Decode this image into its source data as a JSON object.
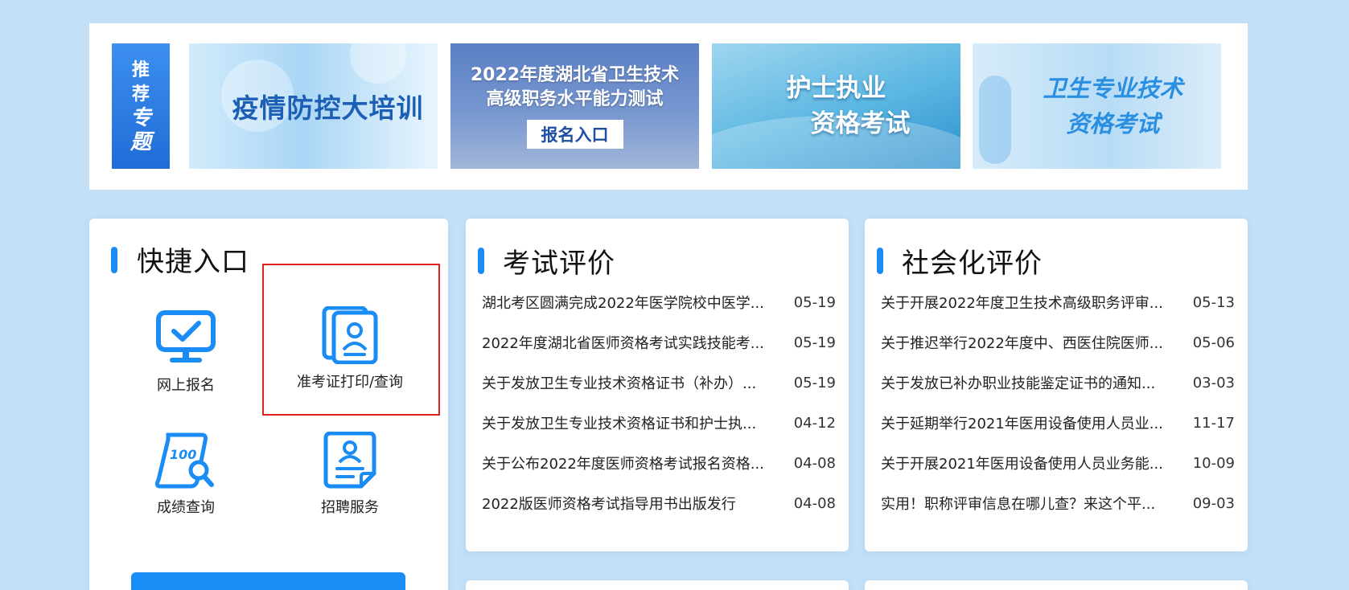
{
  "banner": {
    "tag_chars": [
      "推",
      "荐",
      "专",
      "题"
    ],
    "items": [
      {
        "lines": [
          "疫情防控大培训"
        ]
      },
      {
        "lines": [
          "2022年度湖北省卫生技术",
          "高级职务水平能力测试"
        ],
        "button": "报名入口"
      },
      {
        "lines": [
          "护士执业",
          "资格考试"
        ]
      },
      {
        "lines": [
          "卫生专业技术",
          "资格考试"
        ]
      }
    ]
  },
  "quick": {
    "title": "快捷入口",
    "items": [
      {
        "label": "网上报名",
        "icon": "monitor-check-icon"
      },
      {
        "label": "准考证打印/查询",
        "icon": "id-card-icon"
      },
      {
        "label": "成绩查询",
        "icon": "score-search-icon"
      },
      {
        "label": "招聘服务",
        "icon": "resume-icon"
      }
    ]
  },
  "exam": {
    "title": "考试评价",
    "items": [
      {
        "title": "湖北考区圆满完成2022年医学院校中医学...",
        "date": "05-19"
      },
      {
        "title": "2022年度湖北省医师资格考试实践技能考...",
        "date": "05-19"
      },
      {
        "title": "关于发放卫生专业技术资格证书（补办）...",
        "date": "05-19"
      },
      {
        "title": "关于发放卫生专业技术资格证书和护士执...",
        "date": "04-12"
      },
      {
        "title": "关于公布2022年度医师资格考试报名资格...",
        "date": "04-08"
      },
      {
        "title": "2022版医师资格考试指导用书出版发行",
        "date": "04-08"
      }
    ]
  },
  "social": {
    "title": "社会化评价",
    "items": [
      {
        "title": "关于开展2022年度卫生技术高级职务评审...",
        "date": "05-13"
      },
      {
        "title": "关于推迟举行2022年度中、西医住院医师...",
        "date": "05-06"
      },
      {
        "title": "关于发放已补办职业技能鉴定证书的通知...",
        "date": "03-03"
      },
      {
        "title": "关于延期举行2021年医用设备使用人员业...",
        "date": "11-17"
      },
      {
        "title": "关于开展2021年医用设备使用人员业务能...",
        "date": "10-09"
      },
      {
        "title": "实用！职称评审信息在哪儿查？来这个平...",
        "date": "09-03"
      }
    ]
  },
  "colors": {
    "background": "#c3e0f7",
    "accent": "#1a8cf5",
    "highlight_border": "#e0201d"
  }
}
